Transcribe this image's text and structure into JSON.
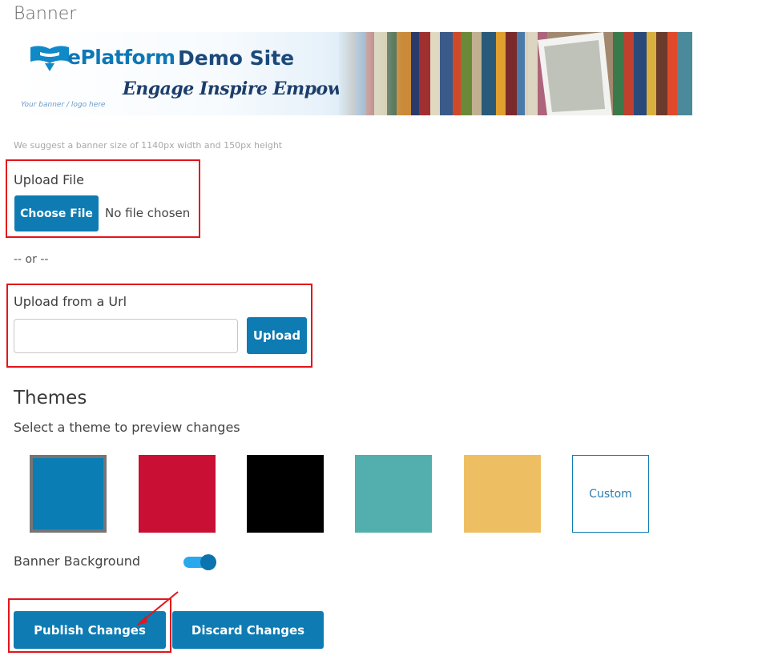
{
  "banner": {
    "title": "Banner",
    "logo_text_primary": "ePlatform",
    "logo_text_secondary": "Demo Site",
    "tagline": "Engage Inspire Empower",
    "logo_caption": "Your banner / logo here",
    "hint": "We suggest a banner size of 1140px width and 150px height"
  },
  "upload_file": {
    "label": "Upload File",
    "button_label": "Choose File",
    "status": "No file chosen"
  },
  "separator": "-- or --",
  "upload_url": {
    "label": "Upload from a Url",
    "input_value": "",
    "input_placeholder": "",
    "button_label": "Upload"
  },
  "themes": {
    "title": "Themes",
    "subtitle": "Select a theme to preview changes",
    "swatches": [
      {
        "color": "#0a7db4",
        "selected": true
      },
      {
        "color": "#c90f34",
        "selected": false
      },
      {
        "color": "#000000",
        "selected": false
      },
      {
        "color": "#53afad",
        "selected": false
      },
      {
        "color": "#eebf62",
        "selected": false
      }
    ],
    "custom_label": "Custom"
  },
  "banner_background": {
    "label": "Banner Background",
    "enabled": true
  },
  "actions": {
    "publish_label": "Publish Changes",
    "discard_label": "Discard Changes"
  },
  "colors": {
    "primary": "#0e7bb3",
    "annotation": "#e2151b"
  }
}
